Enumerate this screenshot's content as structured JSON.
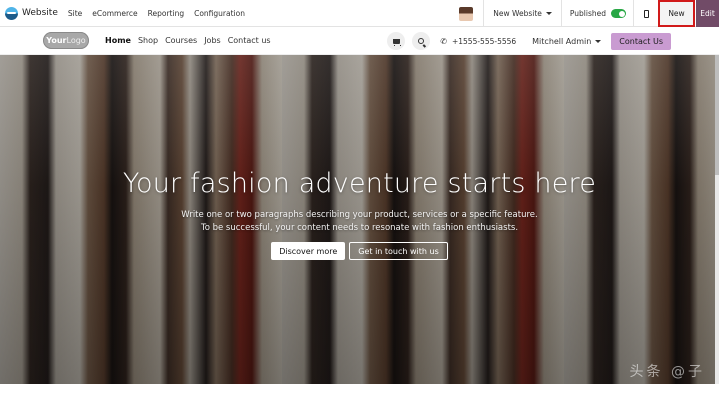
{
  "adminbar": {
    "app_name": "Website",
    "menu": [
      "Site",
      "eCommerce",
      "Reporting",
      "Configuration"
    ],
    "website_selector": "New Website",
    "published_label": "Published",
    "published": true,
    "new_label": "New",
    "edit_label": "Edit",
    "colors": {
      "edit_bg": "#714b67",
      "toggle_on": "#28a745",
      "highlight": "#d11a1a"
    }
  },
  "navbar": {
    "logo_bold": "Your",
    "logo_light": "Logo",
    "links": [
      "Home",
      "Shop",
      "Courses",
      "Jobs",
      "Contact us"
    ],
    "active_link": "Home",
    "phone": "+1555-555-5556",
    "user": "Mitchell Admin",
    "contact_button": "Contact Us",
    "colors": {
      "contact_bg": "#c99bd1"
    }
  },
  "hero": {
    "title": "Your fashion adventure starts here",
    "text_line1": "Write one or two paragraphs describing your product, services or a specific feature.",
    "text_line2": "To be successful, your content needs to resonate with fashion enthusiasts.",
    "primary_button": "Discover more",
    "secondary_button": "Get in touch with us",
    "watermark": "头条 @子"
  }
}
